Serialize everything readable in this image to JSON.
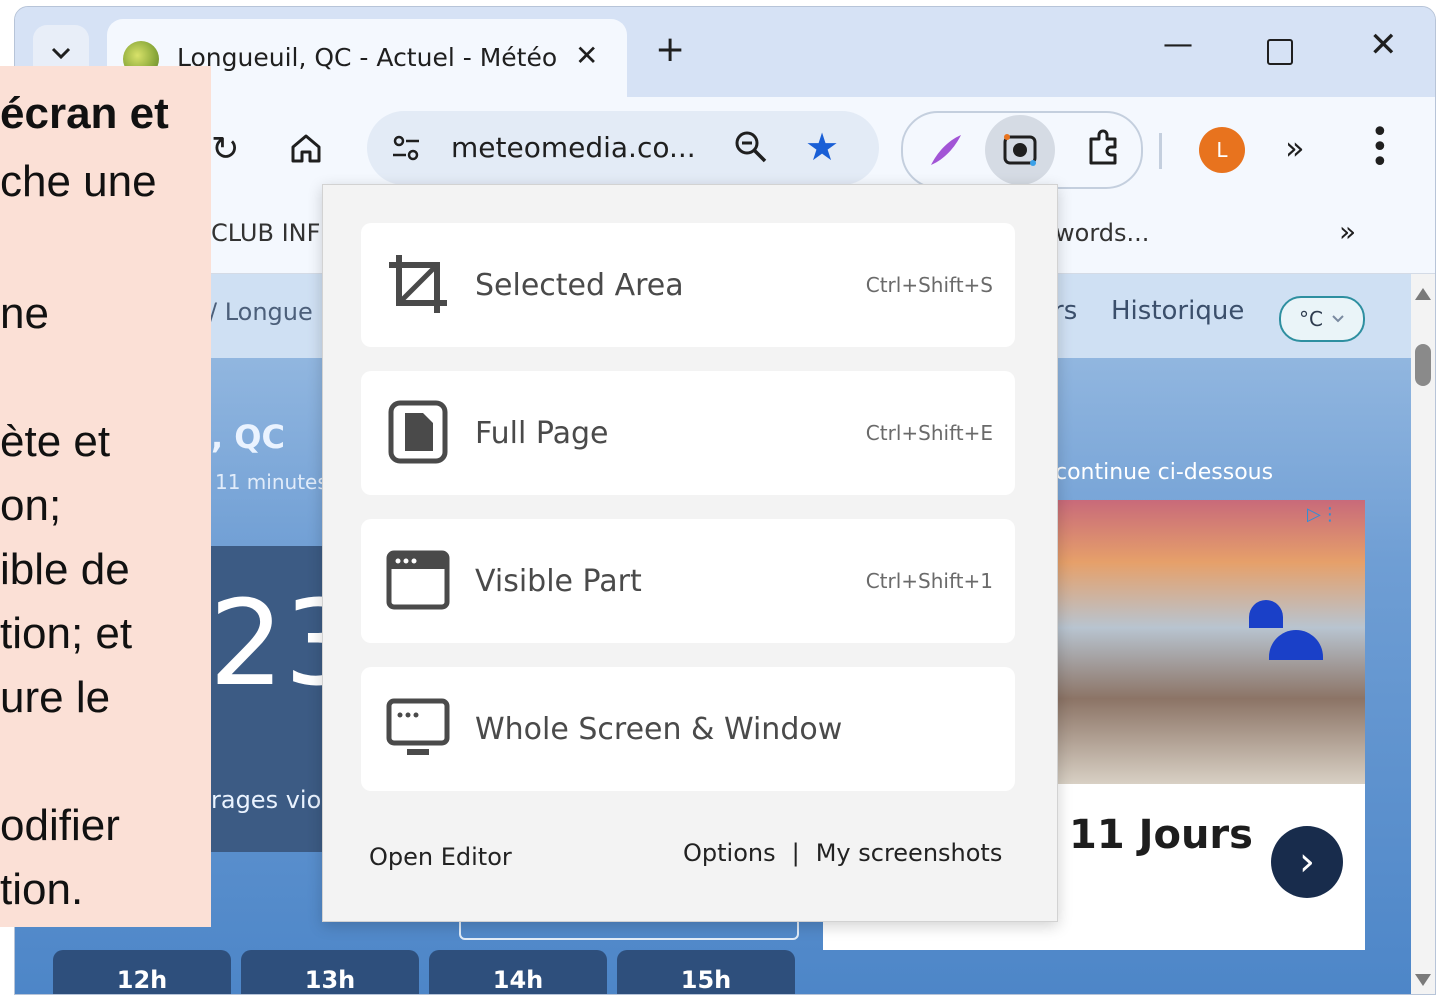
{
  "browser": {
    "tab_title": "Longueuil, QC - Actuel - Météo",
    "url": "meteomedia.co...",
    "avatar_letter": "L",
    "bookmarks": {
      "left": "CLUB INF",
      "right": "words..."
    }
  },
  "website": {
    "breadcrumb": "/ Longue",
    "nav_partial": "rs",
    "nav_history": "Historique",
    "unit": "°C",
    "city": ", QC",
    "updated": "11 minutes",
    "temperature": "23",
    "message": "rages vio",
    "ad_intro": "continue ci-dessous",
    "ad_title": "11 Jours",
    "hours": [
      "12h",
      "13h",
      "14h",
      "15h"
    ]
  },
  "overlay_text": [
    "écran et",
    "che une",
    "",
    "ne",
    "",
    "ète et",
    "on;",
    "ible de",
    "tion; et",
    "ure le",
    "",
    "odifier",
    "tion."
  ],
  "screenshot_menu": {
    "options": [
      {
        "label": "Selected Area",
        "shortcut": "Ctrl+Shift+S",
        "icon": "crop-icon"
      },
      {
        "label": "Full Page",
        "shortcut": "Ctrl+Shift+E",
        "icon": "document-icon"
      },
      {
        "label": "Visible Part",
        "shortcut": "Ctrl+Shift+1",
        "icon": "browser-window-icon"
      },
      {
        "label": "Whole Screen & Window",
        "shortcut": "",
        "icon": "monitor-icon"
      }
    ],
    "open_editor": "Open Editor",
    "options_link": "Options",
    "separator": "|",
    "my_screenshots": "My screenshots"
  }
}
